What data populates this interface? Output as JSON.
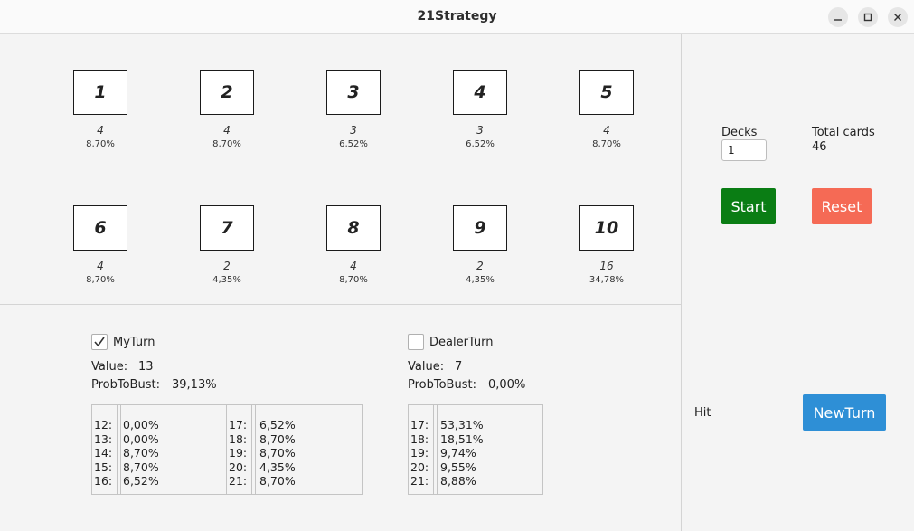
{
  "window": {
    "title": "21Strategy"
  },
  "cards": [
    {
      "label": "1",
      "count": "4",
      "percent": "8,70%"
    },
    {
      "label": "2",
      "count": "4",
      "percent": "8,70%"
    },
    {
      "label": "3",
      "count": "3",
      "percent": "6,52%"
    },
    {
      "label": "4",
      "count": "3",
      "percent": "6,52%"
    },
    {
      "label": "5",
      "count": "4",
      "percent": "8,70%"
    },
    {
      "label": "6",
      "count": "4",
      "percent": "8,70%"
    },
    {
      "label": "7",
      "count": "2",
      "percent": "4,35%"
    },
    {
      "label": "8",
      "count": "4",
      "percent": "8,70%"
    },
    {
      "label": "9",
      "count": "2",
      "percent": "4,35%"
    },
    {
      "label": "10",
      "count": "16",
      "percent": "34,78%"
    }
  ],
  "controls": {
    "decks_label": "Decks",
    "decks_value": "1",
    "total_cards_label": "Total cards",
    "total_cards_value": "46",
    "start_label": "Start",
    "reset_label": "Reset",
    "hit_label": "Hit",
    "new_turn_label": "NewTurn"
  },
  "my_turn": {
    "checkbox_label": "MyTurn",
    "checked": true,
    "value_label": "Value:",
    "value": "13",
    "bust_label": "ProbToBust:",
    "bust_value": "39,13%",
    "table_a_keys": "12:\n13:\n14:\n15:\n16:",
    "table_a_values": "0,00%\n0,00%\n8,70%\n8,70%\n6,52%",
    "table_b_keys": "17:\n18:\n19:\n20:\n21:",
    "table_b_values": "6,52%\n8,70%\n8,70%\n4,35%\n8,70%"
  },
  "dealer_turn": {
    "checkbox_label": "DealerTurn",
    "checked": false,
    "value_label": "Value:",
    "value": "7",
    "bust_label": "ProbToBust:",
    "bust_value": "0,00%",
    "table_keys": "17:\n18:\n19:\n20:\n21:",
    "table_values": "53,31%\n18,51%\n9,74%\n9,55%\n8,88%"
  },
  "colors": {
    "start": "#0a7d14",
    "reset": "#f56a55",
    "new_turn": "#2e8fd6"
  }
}
